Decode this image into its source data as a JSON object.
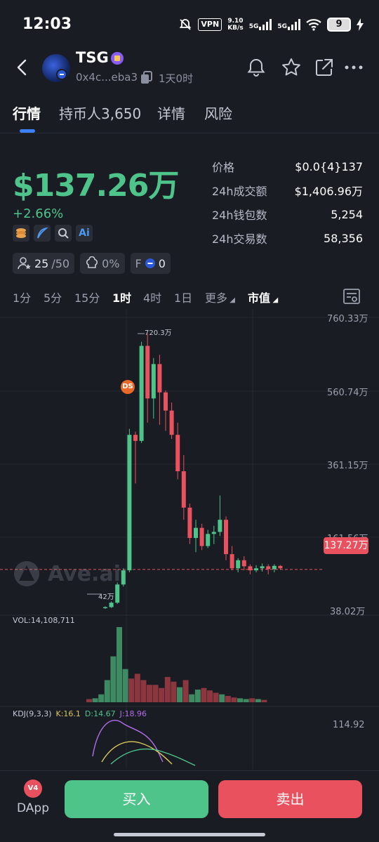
{
  "status_bar": {
    "time": "12:03",
    "vpn": "VPN",
    "net_speed_value": "9.10",
    "net_speed_unit": "KB/s",
    "signal_1": "5G",
    "signal_2": "5G",
    "battery": "9"
  },
  "header": {
    "token_name": "TSG",
    "address": "0x4c...eba3",
    "age": "1天0时"
  },
  "tabs": [
    {
      "label": "行情"
    },
    {
      "label": "持币人3,650"
    },
    {
      "label": "详情"
    },
    {
      "label": "风险"
    }
  ],
  "price": {
    "market_cap": "$137.26万",
    "change": "+2.66%"
  },
  "stats": [
    {
      "label": "价格",
      "value": "$0.0{4}137"
    },
    {
      "label": "24h成交额",
      "value": "$1,406.96万"
    },
    {
      "label": "24h钱包数",
      "value": "5,254"
    },
    {
      "label": "24h交易数",
      "value": "58,356"
    }
  ],
  "chips": {
    "holders_top": "25",
    "holders_total": "/50",
    "dev_pct": "0%",
    "f_label": "F",
    "f_value": "0"
  },
  "feature_icons": [
    "coins-icon",
    "feather-icon",
    "search-icon",
    "ai-icon"
  ],
  "feature_ai_label": "Ai",
  "intervals": [
    {
      "label": "1分"
    },
    {
      "label": "5分"
    },
    {
      "label": "15分"
    },
    {
      "label": "1时"
    },
    {
      "label": "4时"
    },
    {
      "label": "1日"
    },
    {
      "label": "更多"
    },
    {
      "label": "市值"
    }
  ],
  "active_interval": "1时",
  "chart_data": {
    "type": "candlestick",
    "unit": "万",
    "y_axis_labels": [
      "760.33万",
      "560.74万",
      "361.15万",
      "161.56万",
      "38.02万"
    ],
    "ylim": [
      38.02,
      760.33
    ],
    "high_label": "720.3万",
    "low_label": "42万",
    "current_value_label": "137.27万",
    "current_value": 137.27,
    "marker": "DS",
    "watermark": "Ave.ai",
    "candles": [
      {
        "o": 42,
        "h": 46,
        "l": 40,
        "c": 44
      },
      {
        "o": 44,
        "h": 58,
        "l": 42,
        "c": 55
      },
      {
        "o": 55,
        "h": 105,
        "l": 52,
        "c": 100
      },
      {
        "o": 100,
        "h": 140,
        "l": 95,
        "c": 135
      },
      {
        "o": 135,
        "h": 485,
        "l": 130,
        "c": 470
      },
      {
        "o": 470,
        "h": 478,
        "l": 350,
        "c": 455
      },
      {
        "o": 455,
        "h": 700,
        "l": 450,
        "c": 690
      },
      {
        "o": 690,
        "h": 720.3,
        "l": 500,
        "c": 560
      },
      {
        "o": 560,
        "h": 660,
        "l": 510,
        "c": 645
      },
      {
        "o": 645,
        "h": 668,
        "l": 495,
        "c": 575
      },
      {
        "o": 575,
        "h": 580,
        "l": 480,
        "c": 530
      },
      {
        "o": 530,
        "h": 550,
        "l": 460,
        "c": 470
      },
      {
        "o": 470,
        "h": 500,
        "l": 360,
        "c": 380
      },
      {
        "o": 380,
        "h": 420,
        "l": 260,
        "c": 290
      },
      {
        "o": 290,
        "h": 300,
        "l": 200,
        "c": 215
      },
      {
        "o": 215,
        "h": 260,
        "l": 180,
        "c": 240
      },
      {
        "o": 240,
        "h": 250,
        "l": 185,
        "c": 195
      },
      {
        "o": 195,
        "h": 235,
        "l": 190,
        "c": 225
      },
      {
        "o": 225,
        "h": 245,
        "l": 200,
        "c": 230
      },
      {
        "o": 230,
        "h": 320,
        "l": 220,
        "c": 260
      },
      {
        "o": 260,
        "h": 268,
        "l": 160,
        "c": 175
      },
      {
        "o": 175,
        "h": 195,
        "l": 135,
        "c": 140
      },
      {
        "o": 140,
        "h": 165,
        "l": 130,
        "c": 160
      },
      {
        "o": 160,
        "h": 170,
        "l": 135,
        "c": 145
      },
      {
        "o": 145,
        "h": 150,
        "l": 125,
        "c": 135
      },
      {
        "o": 135,
        "h": 148,
        "l": 130,
        "c": 140
      },
      {
        "o": 140,
        "h": 152,
        "l": 132,
        "c": 145
      },
      {
        "o": 145,
        "h": 150,
        "l": 125,
        "c": 138
      },
      {
        "o": 138,
        "h": 150,
        "l": 130,
        "c": 146
      },
      {
        "o": 146,
        "h": 148,
        "l": 136,
        "c": 140
      }
    ],
    "volume_label": "VOL:14,108,711",
    "volume_up": [
      false,
      true,
      true,
      true,
      true,
      true,
      true,
      false,
      false,
      false,
      false,
      false,
      false,
      false,
      false,
      true,
      false,
      true,
      true,
      false,
      false,
      false,
      true,
      false,
      false,
      true,
      true,
      false,
      true,
      false
    ],
    "volume": [
      4,
      5,
      10,
      28,
      58,
      95,
      42,
      30,
      36,
      28,
      22,
      22,
      18,
      32,
      26,
      19,
      28,
      10,
      16,
      18,
      15,
      12,
      10,
      8,
      6,
      5,
      4,
      5,
      4,
      3
    ],
    "kdj_label": "KDJ(9,3,3)",
    "kdj_k": "K:16.1",
    "kdj_d": "D:14.67",
    "kdj_j": "J:18.96",
    "kdj_axis": "114.92"
  },
  "bottom": {
    "dapp_label": "DApp",
    "buy_label": "买入",
    "sell_label": "卖出"
  },
  "colors": {
    "up": "#4fc48a",
    "down": "#e8515d",
    "accent": "#3b82f6",
    "background": "#1a1c23"
  }
}
